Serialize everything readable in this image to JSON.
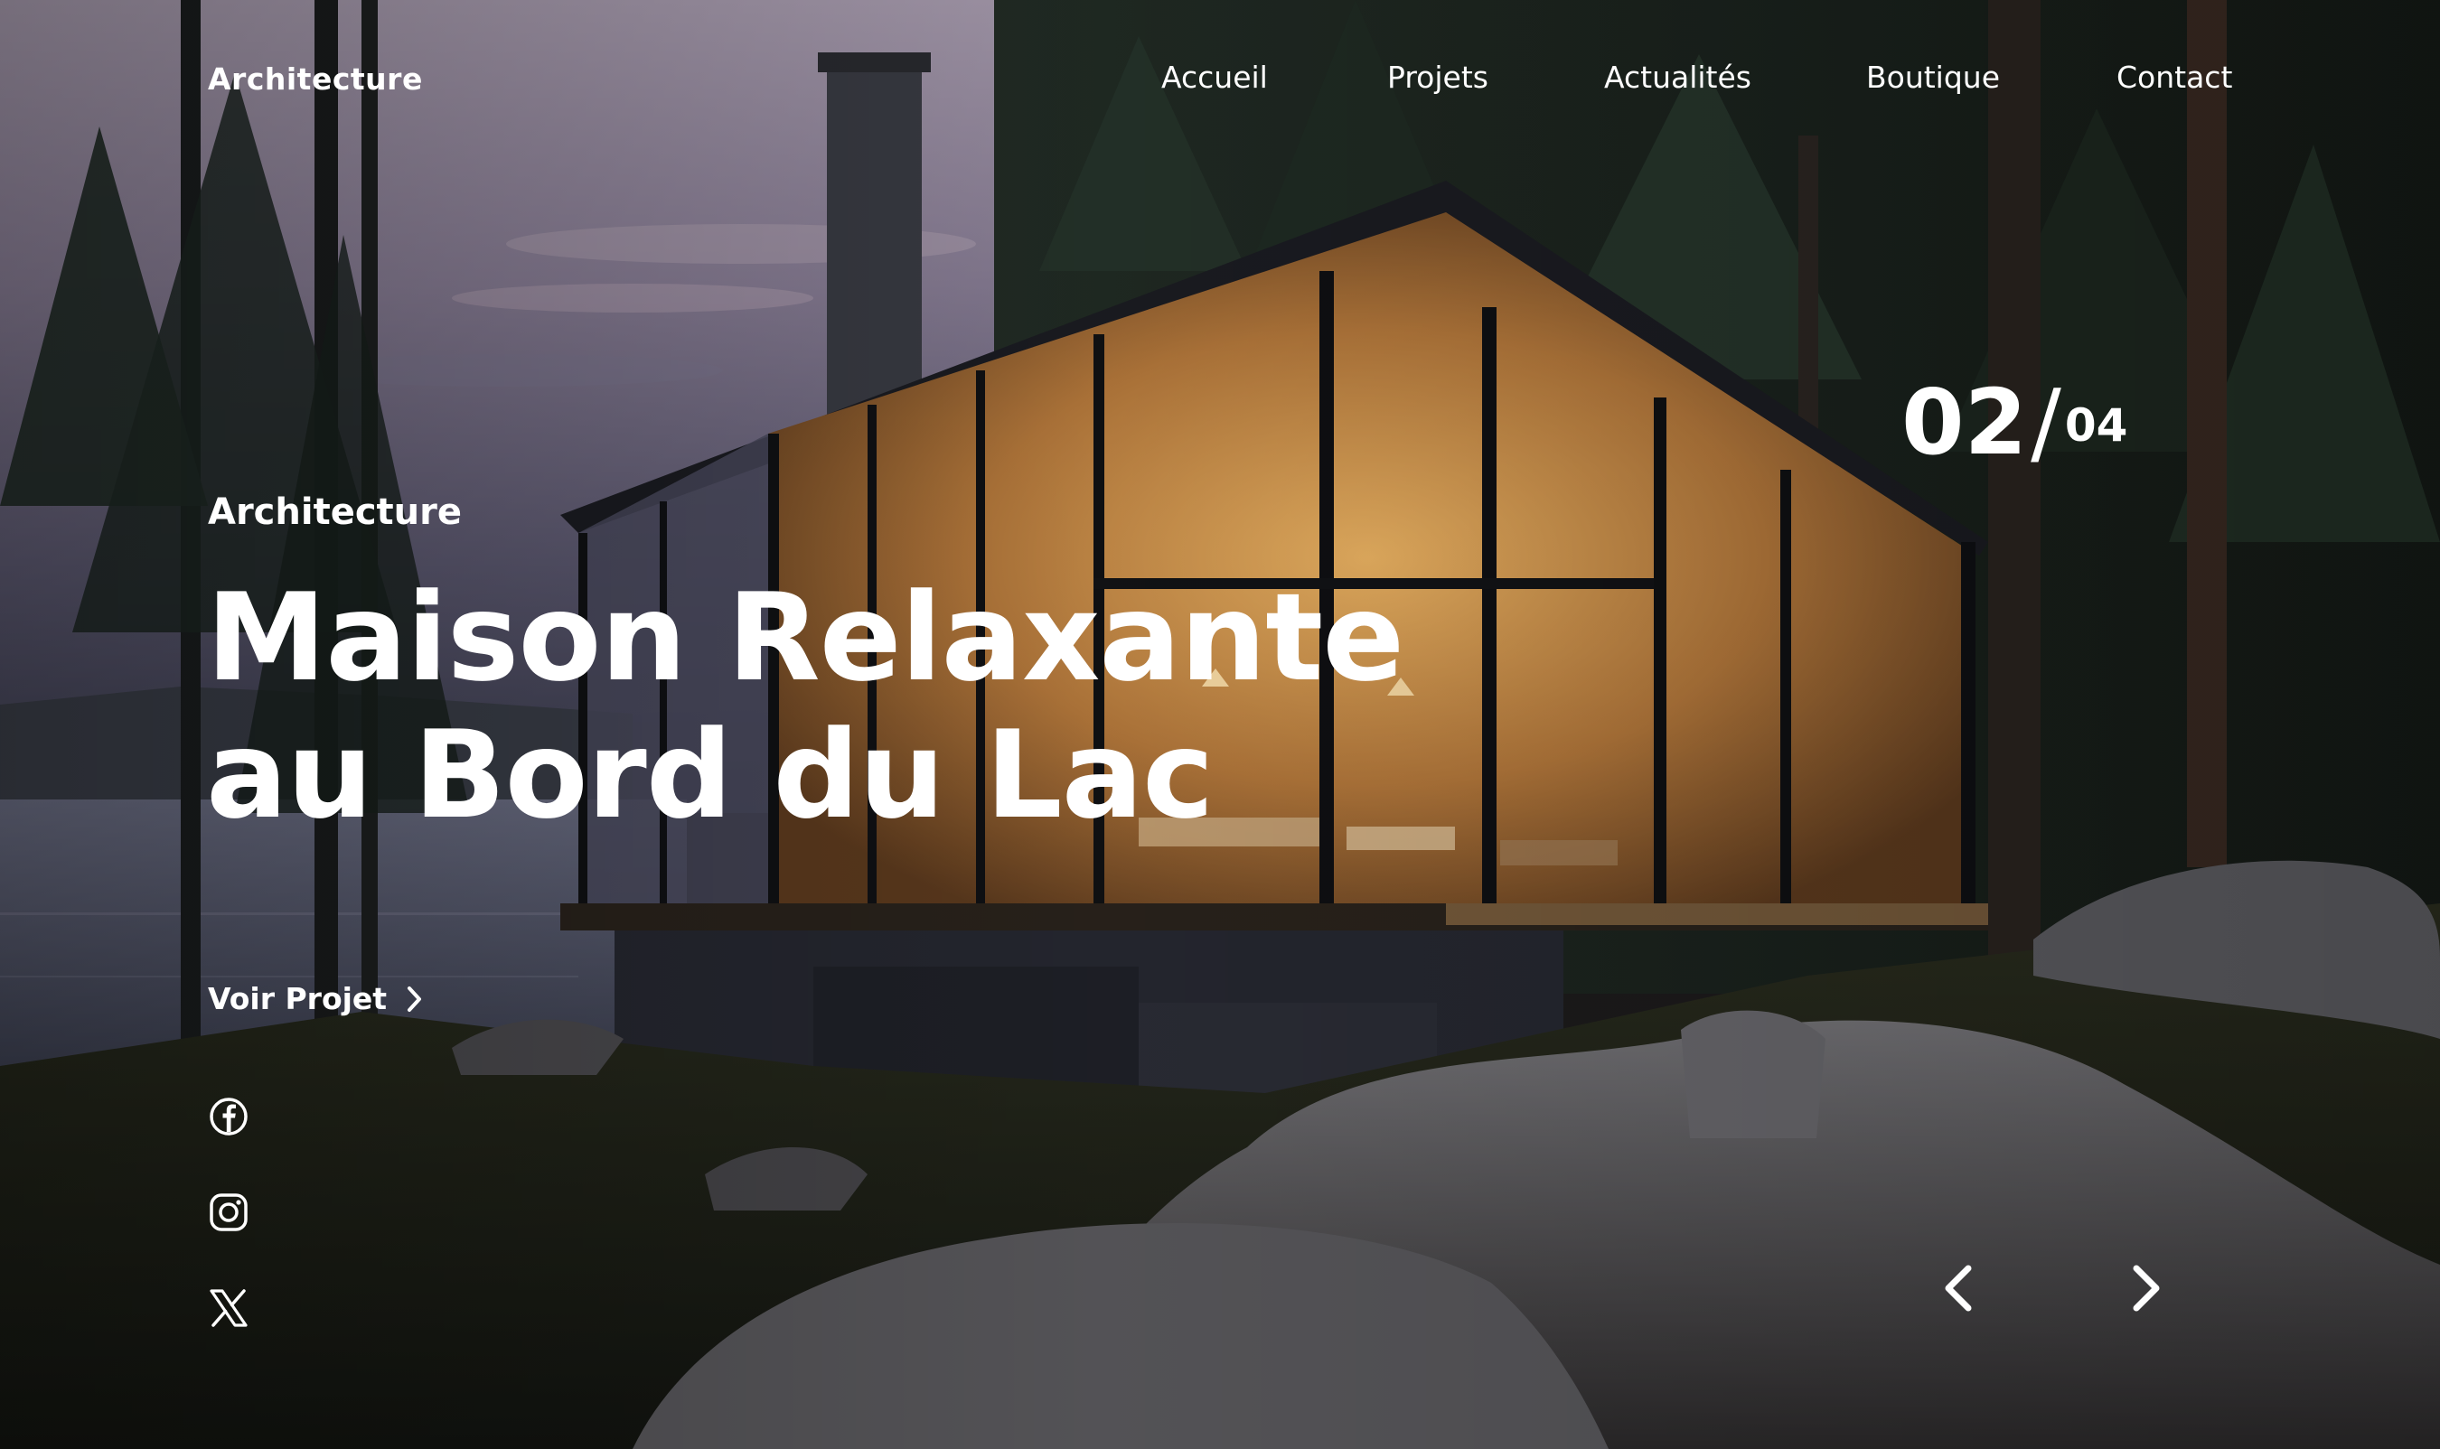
{
  "brand": "Architecture",
  "nav": {
    "items": [
      "Accueil",
      "Projets",
      "Actualités",
      "Boutique",
      "Contact"
    ]
  },
  "slider": {
    "current": "02",
    "separator": "/",
    "total": "04"
  },
  "hero": {
    "category": "Architecture",
    "title_line1": "Maison Relaxante",
    "title_line2": "au Bord du Lac",
    "cta_label": "Voir Projet"
  },
  "social": {
    "icons": [
      "facebook-icon",
      "instagram-icon",
      "x-icon"
    ]
  },
  "colors": {
    "text": "#ffffff",
    "warm_glow": "#d99a4e",
    "forest": "#1e2a22",
    "sky": "#9f8e9e"
  }
}
